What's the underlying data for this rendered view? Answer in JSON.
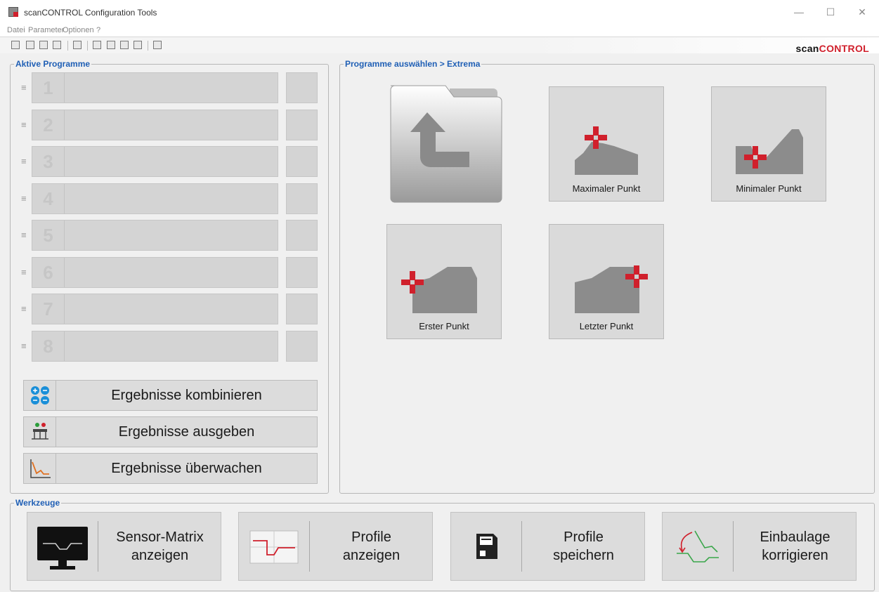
{
  "window": {
    "title": "scanCONTROL Configuration Tools",
    "controls": {
      "minimize": "—",
      "maximize": "☐",
      "close": "✕"
    }
  },
  "menu": [
    "Datei",
    "Parameter",
    "Optionen",
    "?"
  ],
  "logo": {
    "scan": "scan",
    "control": "CONTROL",
    "accent_color": "#d0202c"
  },
  "active_programs": {
    "title": "Aktive Programme",
    "slots": [
      "1",
      "2",
      "3",
      "4",
      "5",
      "6",
      "7",
      "8"
    ],
    "handle_glyph": "≡"
  },
  "result_buttons": [
    {
      "label": "Ergebnisse kombinieren",
      "icon": "combine-icon"
    },
    {
      "label": "Ergebnisse ausgeben",
      "icon": "output-icon"
    },
    {
      "label": "Ergebnisse überwachen",
      "icon": "monitor-chart-icon"
    }
  ],
  "program_select": {
    "title": "Programme auswählen > Extrema",
    "back_icon": "folder-back-icon",
    "tiles": [
      {
        "label": "Maximaler Punkt",
        "icon": "max-point-icon"
      },
      {
        "label": "Minimaler Punkt",
        "icon": "min-point-icon"
      },
      {
        "label": "Erster Punkt",
        "icon": "first-point-icon"
      },
      {
        "label": "Letzter Punkt",
        "icon": "last-point-icon"
      }
    ]
  },
  "tools": {
    "title": "Werkzeuge",
    "buttons": [
      {
        "label": "Sensor-Matrix\nanzeigen",
        "icon": "monitor-icon"
      },
      {
        "label": "Profile\nanzeigen",
        "icon": "profile-chart-icon"
      },
      {
        "label": "Profile\nspeichern",
        "icon": "floppy-disk-icon"
      },
      {
        "label": "Einbaulage\nkorrigieren",
        "icon": "rotate-profile-icon"
      }
    ]
  },
  "colors": {
    "accent_blue": "#1f5fb5",
    "marker_red": "#d0202c"
  }
}
